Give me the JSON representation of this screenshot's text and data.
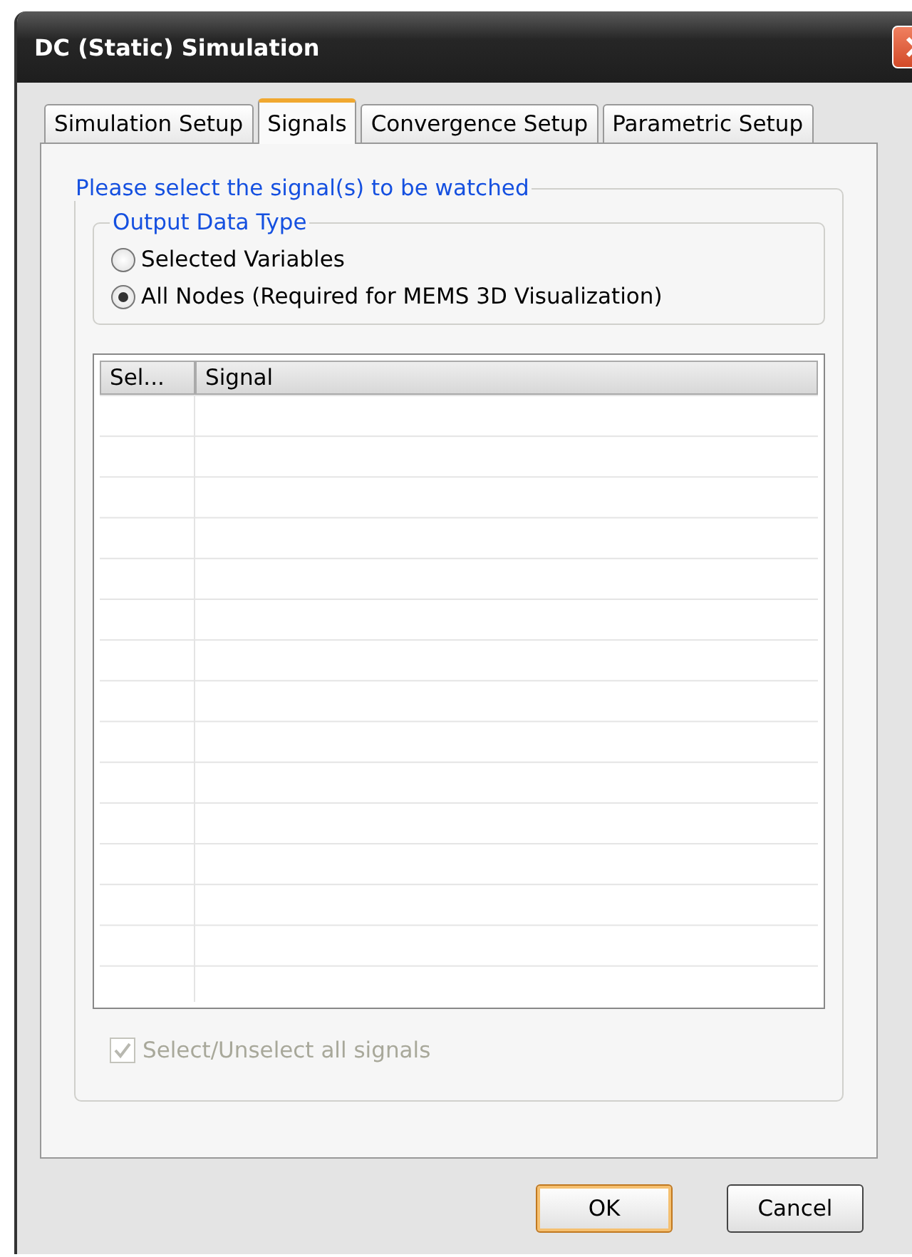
{
  "window": {
    "title": "DC (Static) Simulation"
  },
  "tabs": [
    {
      "label": "Simulation Setup",
      "selected": false
    },
    {
      "label": "Signals",
      "selected": true
    },
    {
      "label": "Convergence Setup",
      "selected": false
    },
    {
      "label": "Parametric Setup",
      "selected": false
    }
  ],
  "signals_group": {
    "title": "Please select the signal(s) to be  watched",
    "output_type": {
      "title": "Output Data Type",
      "options": [
        {
          "label": "Selected Variables",
          "selected": false
        },
        {
          "label": "All Nodes (Required for MEMS 3D Visualization)",
          "selected": true
        }
      ]
    },
    "table": {
      "columns": [
        "Sel...",
        "Signal"
      ]
    },
    "select_all": {
      "label": "Select/Unselect all signals",
      "checked": true,
      "disabled": true
    }
  },
  "buttons": [
    {
      "label": "OK",
      "default": true
    },
    {
      "label": "Cancel",
      "default": false
    }
  ]
}
